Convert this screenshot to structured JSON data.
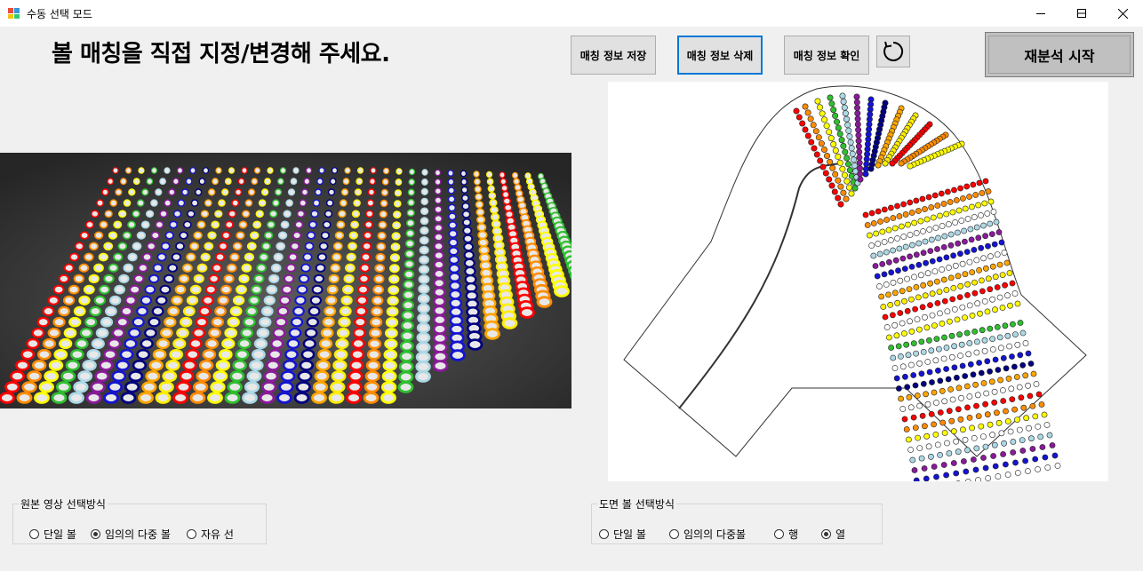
{
  "window": {
    "title": "수동 선택 모드"
  },
  "heading": "볼 매칭을 직접 지정/변경해 주세요.",
  "toolbar": {
    "save_label": "매칭 정보 저장",
    "delete_label": "매칭 정보 삭제",
    "check_label": "매칭 정보 확인",
    "reanalyze_label": "재분석 시작"
  },
  "source_group": {
    "title": "원본 영상 선택방식",
    "options": [
      "단일 볼",
      "임의의 다중 볼",
      "자유 선"
    ],
    "selected": 1
  },
  "drawing_group": {
    "title": "도면 볼 선택방식",
    "options": [
      "단일 볼",
      "임의의 다중볼",
      "행",
      "열"
    ],
    "selected": 3
  },
  "palette": [
    "#ff0000",
    "#ff8c00",
    "#ffff00",
    "#2fbf2f",
    "#add8e6",
    "#8b1a9b",
    "#1414d2",
    "#000080",
    "#ffa500",
    "#ffee00"
  ],
  "colors": {
    "accent": "#0078d7",
    "window_bg": "#f0f0f0"
  }
}
